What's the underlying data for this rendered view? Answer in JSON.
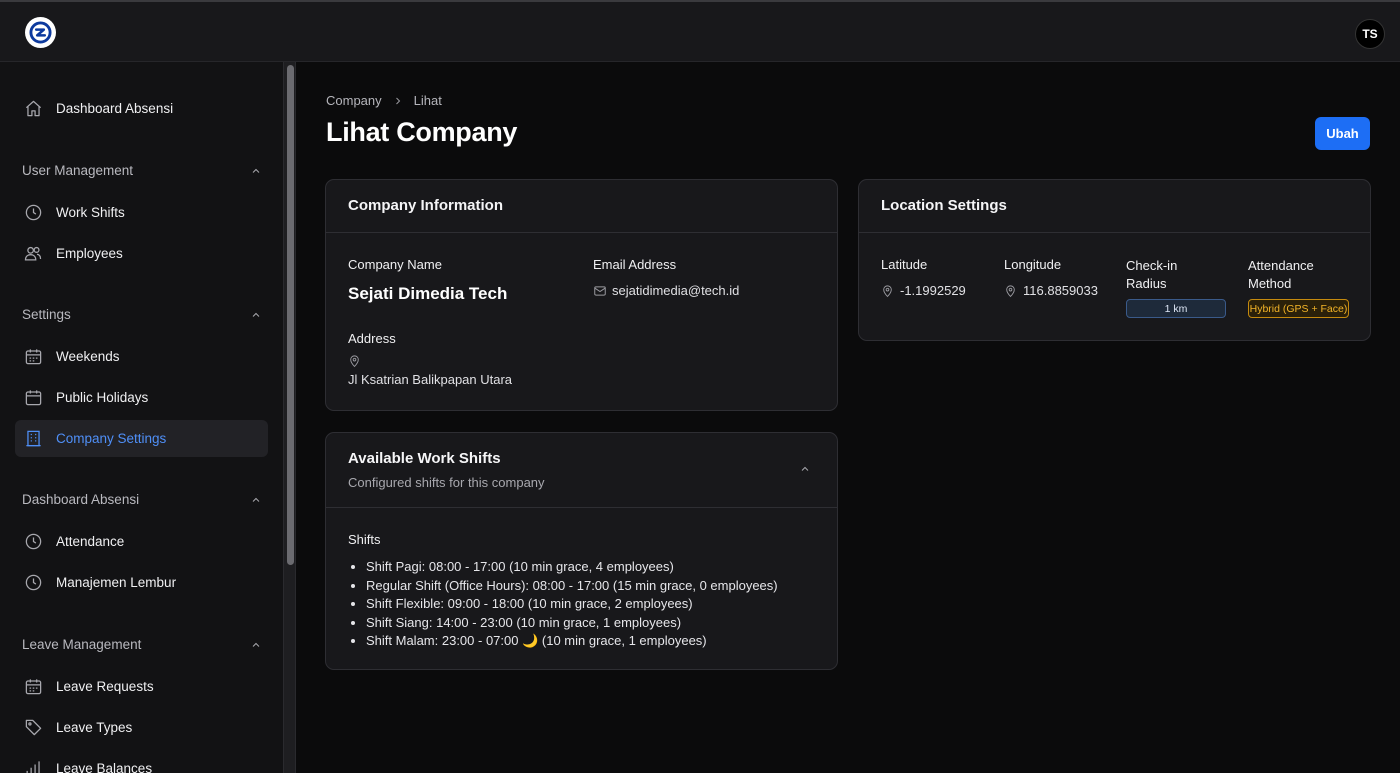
{
  "header": {
    "avatar_initials": "TS"
  },
  "sidebar": {
    "top_item": "Dashboard Absensi",
    "sections": [
      {
        "title": "User Management",
        "items": [
          "Work Shifts",
          "Employees"
        ]
      },
      {
        "title": "Settings",
        "items": [
          "Weekends",
          "Public Holidays",
          "Company Settings"
        ]
      },
      {
        "title": "Dashboard Absensi",
        "items": [
          "Attendance",
          "Manajemen Lembur"
        ]
      },
      {
        "title": "Leave Management",
        "items": [
          "Leave Requests",
          "Leave Types",
          "Leave Balances"
        ]
      }
    ],
    "active_item": "Company Settings"
  },
  "breadcrumb": {
    "parent": "Company",
    "current": "Lihat"
  },
  "page": {
    "title": "Lihat Company",
    "edit_button": "Ubah"
  },
  "company_info": {
    "heading": "Company Information",
    "company_name_label": "Company Name",
    "company_name": "Sejati Dimedia Tech",
    "email_label": "Email Address",
    "email": "sejatidimedia@tech.id",
    "address_label": "Address",
    "address": "Jl Ksatrian Balikpapan Utara"
  },
  "location": {
    "heading": "Location Settings",
    "latitude_label": "Latitude",
    "latitude": "-1.1992529",
    "longitude_label": "Longitude",
    "longitude": "116.8859033",
    "radius_label_1": "Check-in",
    "radius_label_2": "Radius",
    "radius": "1 km",
    "method_label_1": "Attendance",
    "method_label_2": "Method",
    "method": "Hybrid (GPS + Face)"
  },
  "work_shifts": {
    "heading": "Available Work Shifts",
    "subheading": "Configured shifts for this company",
    "shifts_label": "Shifts",
    "items": [
      "Shift Pagi: 08:00 - 17:00 (10 min grace, 4 employees)",
      "Regular Shift (Office Hours): 08:00 - 17:00 (15 min grace, 0 employees)",
      "Shift Flexible: 09:00 - 18:00 (10 min grace, 2 employees)",
      "Shift Siang: 14:00 - 23:00 (10 min grace, 1 employees)",
      "Shift Malam: 23:00 - 07:00 🌙 (10 min grace, 1 employees)"
    ]
  },
  "colors": {
    "accent": "#1d6ef5",
    "active_nav": "#4f8ff7",
    "badge_yellow": "#f3b428"
  }
}
